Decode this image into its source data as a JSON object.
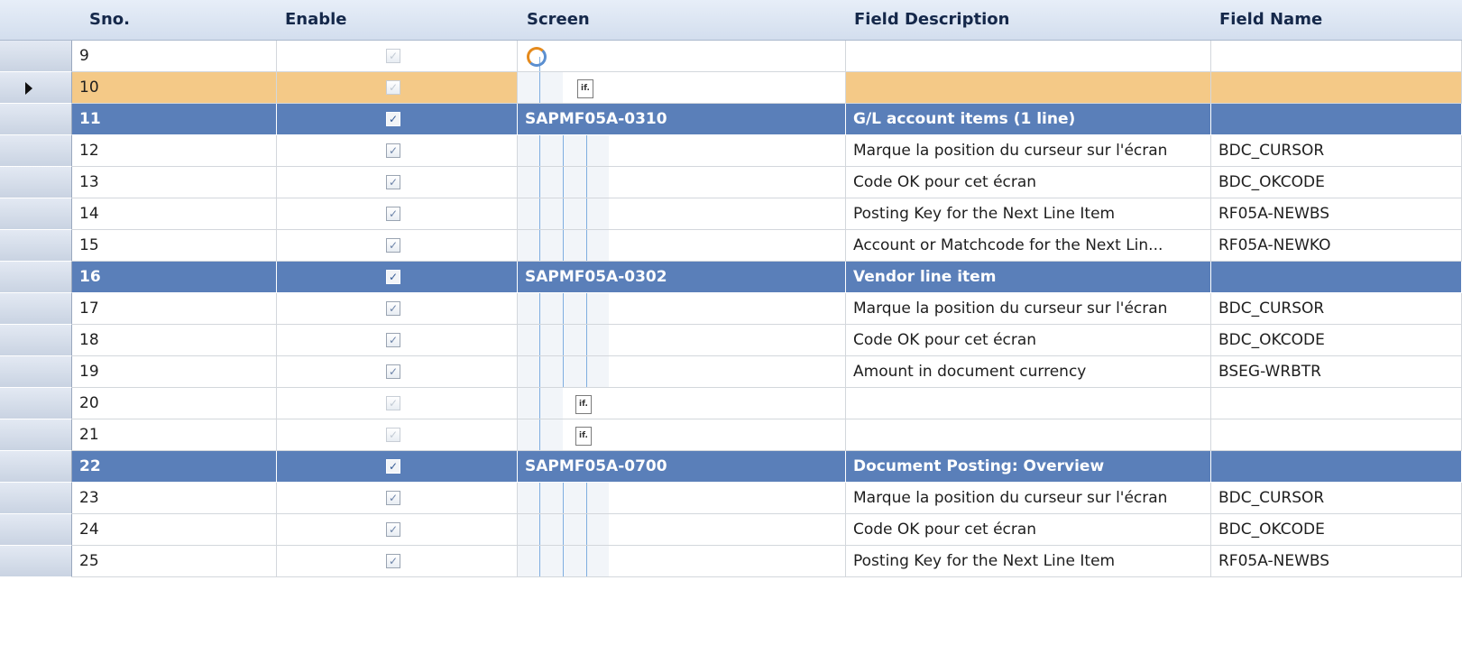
{
  "columns": {
    "sno": "Sno.",
    "enable": "Enable",
    "screen": "Screen",
    "field_description": "Field Description",
    "field_name": "Field Name"
  },
  "icons": {
    "checkbox": "check-icon",
    "refresh": "refresh-icon",
    "field_page": "page-icon",
    "page_glyph": "if."
  },
  "colors": {
    "group_row": "#5a7fb9",
    "selected_row": "#f4c987",
    "header": "#d3deee"
  },
  "rows": [
    {
      "sno": "9",
      "enabled": true,
      "dim": true,
      "kind": "refresh",
      "screen": "",
      "desc": "",
      "name": ""
    },
    {
      "sno": "10",
      "enabled": true,
      "dim": true,
      "kind": "page",
      "screen": "",
      "desc": "",
      "name": "",
      "selected": true
    },
    {
      "sno": "11",
      "enabled": true,
      "kind": "group",
      "screen": "SAPMF05A-0310",
      "desc": "G/L account items (1 line)",
      "name": ""
    },
    {
      "sno": "12",
      "enabled": true,
      "kind": "field",
      "screen": "",
      "desc": "Marque la position du curseur sur l'écran",
      "name": "BDC_CURSOR"
    },
    {
      "sno": "13",
      "enabled": true,
      "kind": "field",
      "screen": "",
      "desc": "Code OK pour cet écran",
      "name": "BDC_OKCODE"
    },
    {
      "sno": "14",
      "enabled": true,
      "kind": "field",
      "screen": "",
      "desc": "Posting Key for the Next Line Item",
      "name": "RF05A-NEWBS"
    },
    {
      "sno": "15",
      "enabled": true,
      "kind": "field",
      "screen": "",
      "desc": "Account or Matchcode for the Next Lin...",
      "name": "RF05A-NEWKO"
    },
    {
      "sno": "16",
      "enabled": true,
      "kind": "group",
      "screen": "SAPMF05A-0302",
      "desc": "Vendor line item",
      "name": ""
    },
    {
      "sno": "17",
      "enabled": true,
      "kind": "field",
      "screen": "",
      "desc": "Marque la position du curseur sur l'écran",
      "name": "BDC_CURSOR"
    },
    {
      "sno": "18",
      "enabled": true,
      "kind": "field",
      "screen": "",
      "desc": "Code OK pour cet écran",
      "name": "BDC_OKCODE"
    },
    {
      "sno": "19",
      "enabled": true,
      "kind": "field",
      "screen": "",
      "desc": "Amount in document currency",
      "name": "BSEG-WRBTR"
    },
    {
      "sno": "20",
      "enabled": true,
      "dim": true,
      "kind": "page",
      "screen": "",
      "desc": "",
      "name": ""
    },
    {
      "sno": "21",
      "enabled": true,
      "dim": true,
      "kind": "page",
      "screen": "",
      "desc": "",
      "name": ""
    },
    {
      "sno": "22",
      "enabled": true,
      "kind": "group",
      "screen": "SAPMF05A-0700",
      "desc": "Document Posting: Overview",
      "name": ""
    },
    {
      "sno": "23",
      "enabled": true,
      "kind": "field",
      "screen": "",
      "desc": "Marque la position du curseur sur l'écran",
      "name": "BDC_CURSOR"
    },
    {
      "sno": "24",
      "enabled": true,
      "kind": "field",
      "screen": "",
      "desc": "Code OK pour cet écran",
      "name": "BDC_OKCODE"
    },
    {
      "sno": "25",
      "enabled": true,
      "kind": "field",
      "screen": "",
      "desc": "Posting Key for the Next Line Item",
      "name": "RF05A-NEWBS"
    }
  ]
}
